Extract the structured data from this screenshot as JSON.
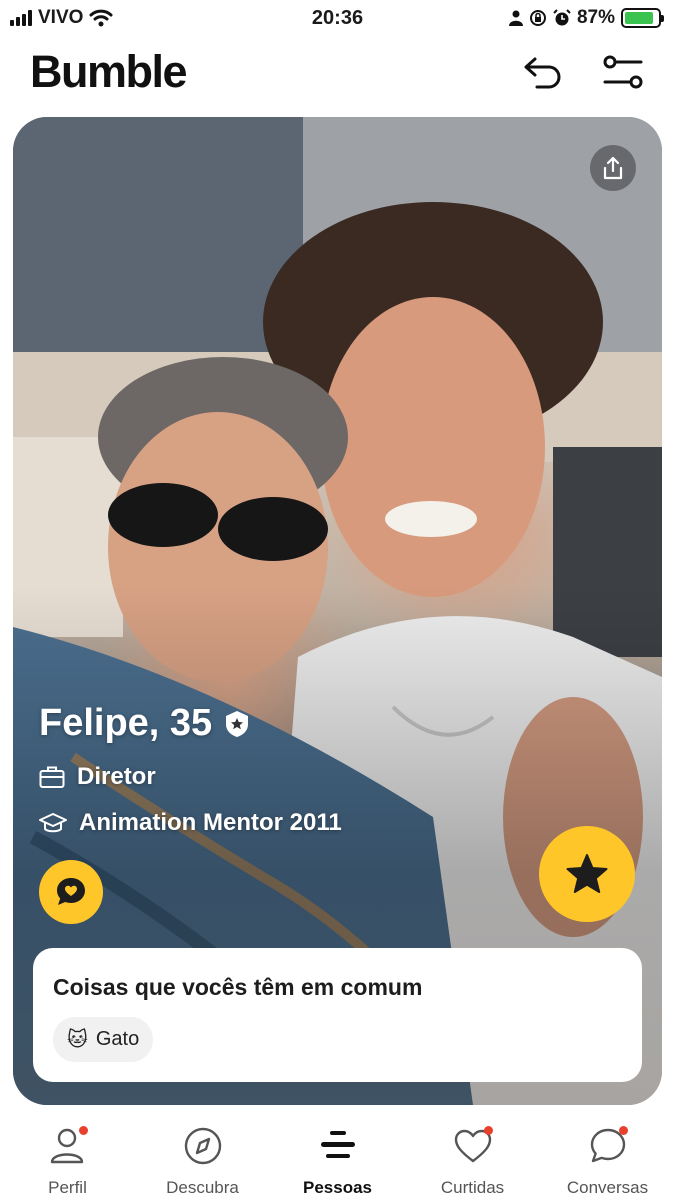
{
  "status_bar": {
    "carrier": "VIVO",
    "time": "20:36",
    "battery_percent": "87%",
    "battery_level": 0.87,
    "icons": [
      "signal-icon",
      "wifi-icon",
      "person-icon",
      "lock-rotation-icon",
      "alarm-icon",
      "battery-charging-icon"
    ]
  },
  "header": {
    "logo": "Bumble",
    "undo_icon": "undo-icon",
    "filter_icon": "filter-settings-icon"
  },
  "profile": {
    "name_age": "Felipe, 35",
    "verified_icon": "verified-badge-icon",
    "job": "Diretor",
    "education": "Animation Mentor 2011",
    "job_icon": "briefcase-icon",
    "education_icon": "graduation-cap-icon",
    "share_icon": "share-icon",
    "compliment_icon": "compliment-heart-bubble-icon",
    "superswipe_icon": "star-icon"
  },
  "common": {
    "title": "Coisas que vocês têm em comum",
    "items": [
      {
        "emoji": "🐱",
        "label": "Gato"
      }
    ]
  },
  "nav": {
    "items": [
      {
        "label": "Perfil",
        "icon": "person-outline-icon",
        "badge": true,
        "active": false
      },
      {
        "label": "Descubra",
        "icon": "compass-icon",
        "badge": false,
        "active": false
      },
      {
        "label": "Pessoas",
        "icon": "stack-icon",
        "badge": false,
        "active": true
      },
      {
        "label": "Curtidas",
        "icon": "heart-outline-icon",
        "badge": true,
        "active": false
      },
      {
        "label": "Conversas",
        "icon": "chat-bubble-icon",
        "badge": true,
        "active": false
      }
    ]
  },
  "colors": {
    "accent": "#ffc629",
    "badge": "#e8402d",
    "battery": "#3ac44f"
  }
}
